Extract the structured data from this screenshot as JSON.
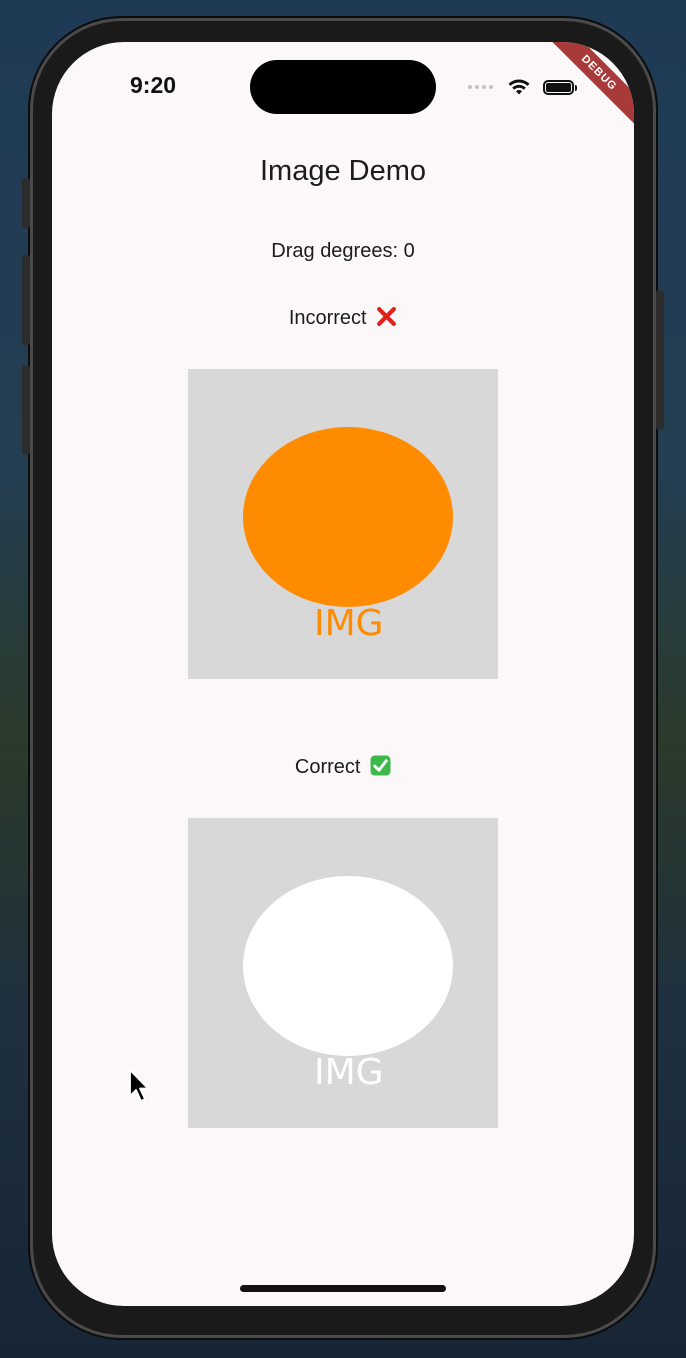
{
  "status_bar": {
    "time": "9:20"
  },
  "debug_banner": "DEBUG",
  "app_bar": {
    "title": "Image Demo"
  },
  "drag": {
    "text": "Drag degrees: 0"
  },
  "incorrect_section": {
    "label": "Incorrect",
    "emoji": "cross-mark-icon",
    "image": {
      "text": "IMG",
      "ellipse_color": "#ff8c00",
      "text_color": "#ff8c00",
      "background_color": "#d8d8d8"
    }
  },
  "correct_section": {
    "label": "Correct",
    "emoji": "check-mark-button-icon",
    "image": {
      "text": "IMG",
      "ellipse_color": "#ffffff",
      "text_color": "#ffffff",
      "background_color": "#d8d8d8"
    }
  }
}
